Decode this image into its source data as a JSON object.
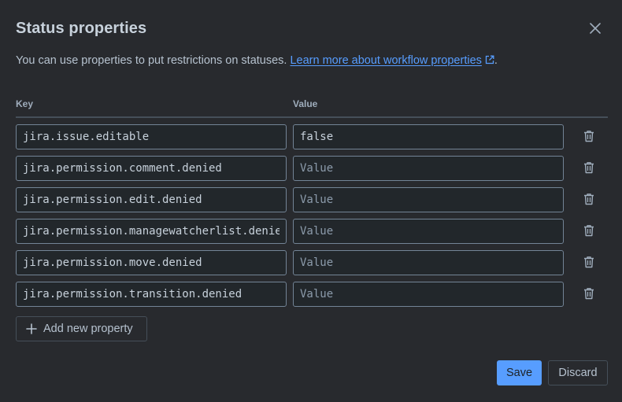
{
  "dialog": {
    "title": "Status properties",
    "description": "You can use properties to put restrictions on statuses.",
    "link_text": "Learn more about workflow properties",
    "after_link": "."
  },
  "columns": {
    "key": "Key",
    "value": "Value"
  },
  "value_placeholder": "Value",
  "properties": [
    {
      "key": "jira.issue.editable",
      "value": "false"
    },
    {
      "key": "jira.permission.comment.denied",
      "value": ""
    },
    {
      "key": "jira.permission.edit.denied",
      "value": ""
    },
    {
      "key": "jira.permission.managewatcherlist.denied",
      "value": ""
    },
    {
      "key": "jira.permission.move.denied",
      "value": ""
    },
    {
      "key": "jira.permission.transition.denied",
      "value": ""
    }
  ],
  "buttons": {
    "add": "Add new property",
    "save": "Save",
    "discard": "Discard"
  },
  "icons": {
    "close": "close-icon",
    "external_link": "external-link-icon",
    "delete": "trash-icon",
    "add": "plus-icon"
  },
  "colors": {
    "background": "#282a2e",
    "link": "#579dff",
    "primary_button": "#579dff",
    "field_border": "#738496"
  }
}
